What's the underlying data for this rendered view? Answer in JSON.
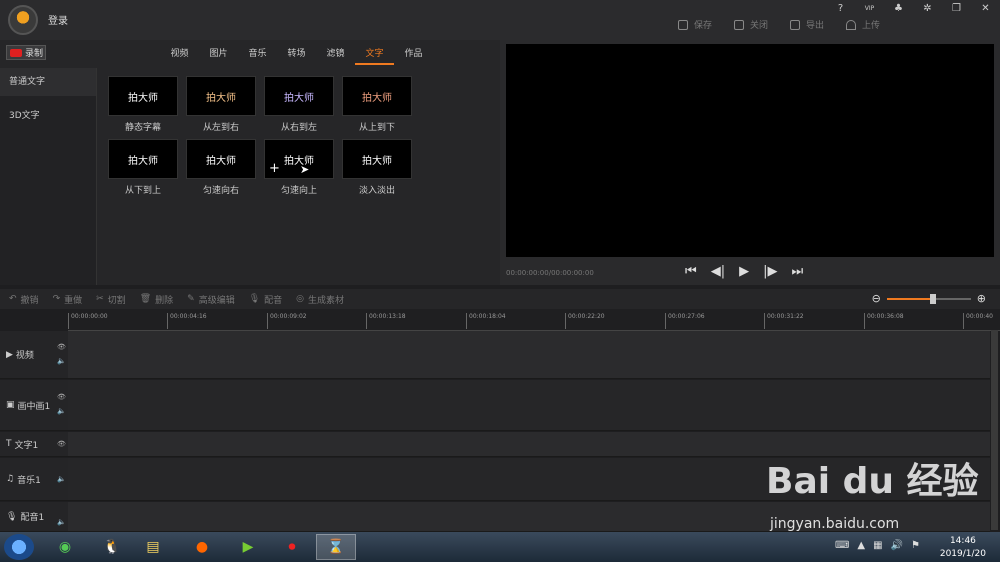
{
  "header": {
    "login": "登录",
    "help": "?",
    "vip": "VIP",
    "actions": [
      {
        "label": "保存",
        "icon": "save-icon"
      },
      {
        "label": "关闭",
        "icon": "exit-icon"
      },
      {
        "label": "导出",
        "icon": "export-icon"
      },
      {
        "label": "上传",
        "icon": "upload-icon"
      }
    ]
  },
  "record_label": "录制",
  "tabs": [
    "视频",
    "图片",
    "音乐",
    "转场",
    "滤镜",
    "文字",
    "作品"
  ],
  "active_tab": "文字",
  "sidebar": [
    "普通文字",
    "3D文字"
  ],
  "tiles": [
    {
      "preview": "拍大师",
      "caption": "静态字幕"
    },
    {
      "preview": "拍大师",
      "caption": "从左到右"
    },
    {
      "preview": "拍大师",
      "caption": "从右到左"
    },
    {
      "preview": "拍大师",
      "caption": "从上到下"
    },
    {
      "preview": "拍大师",
      "caption": "从下到上"
    },
    {
      "preview": "拍大师",
      "caption": "匀速向右"
    },
    {
      "preview": "拍大师",
      "caption": "匀速向上"
    },
    {
      "preview": "拍大师",
      "caption": "淡入淡出"
    }
  ],
  "preview": {
    "timecode": "00:00:00:00/00:00:00:00"
  },
  "toolbar": [
    "撤销",
    "重做",
    "切割",
    "删除",
    "高级编辑",
    "配音",
    "生成素材"
  ],
  "zoom_level": 0.55,
  "ruler": [
    "00:00:00:00",
    "00:00:04:16",
    "00:00:09:02",
    "00:00:13:18",
    "00:00:18:04",
    "00:00:22:20",
    "00:00:27:06",
    "00:00:31:22",
    "00:00:36:08",
    "00:00:40"
  ],
  "tracks": [
    "视频",
    "画中画1",
    "文字1",
    "音乐1",
    "配音1"
  ],
  "taskbar": {
    "time": "14:46",
    "date": "2019/1/20"
  },
  "watermark": {
    "brand": "Bai du 经验",
    "url": "jingyan.baidu.com"
  },
  "colors": {
    "accent": "#f07a20",
    "record": "#e02020"
  }
}
